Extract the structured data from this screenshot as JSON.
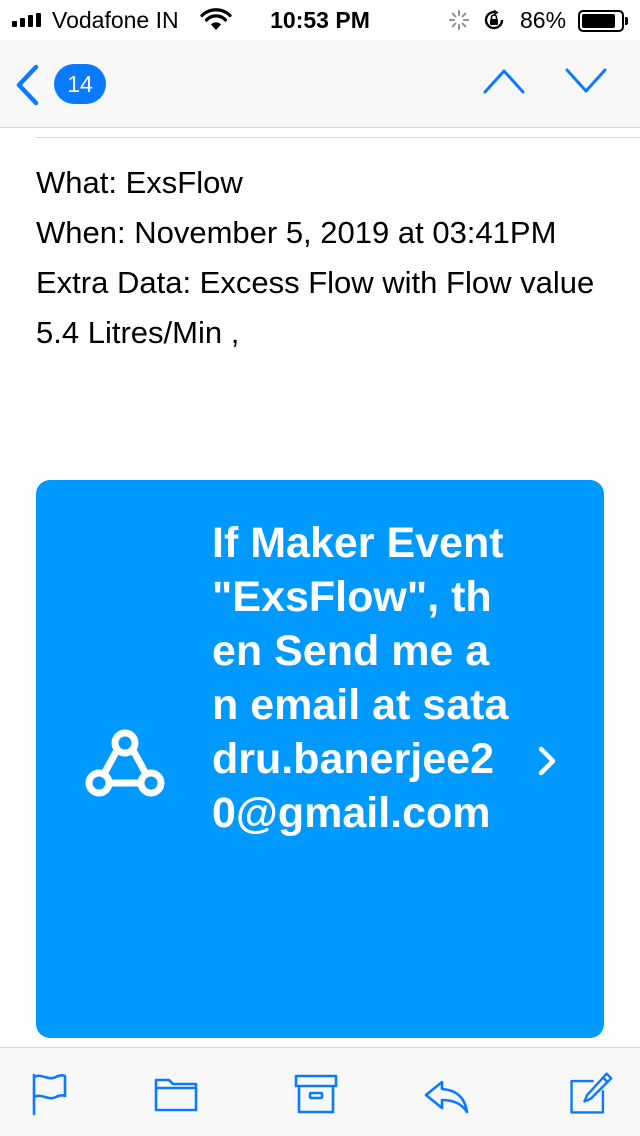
{
  "status_bar": {
    "carrier": "Vodafone IN",
    "time": "10:53 PM",
    "battery_percent": "86%",
    "battery_level": 0.86,
    "icons": [
      "signal-icon",
      "wifi-icon",
      "activity-spinner-icon",
      "rotation-lock-icon",
      "battery-icon"
    ]
  },
  "nav": {
    "back_badge": "14",
    "icons": [
      "back-chevron-icon",
      "chevron-up-icon",
      "chevron-down-icon"
    ]
  },
  "email": {
    "lines": [
      "What: ExsFlow",
      "When: November 5, 2019 at 03:41PM",
      "Extra Data: Excess Flow with Flow value 5.4 Litres/Min ,"
    ]
  },
  "card": {
    "text": "If Maker Event \"ExsFlow\", then Send me an email at satadru.banerjee20@gmail.com",
    "color": "#0099ff",
    "icons": [
      "webhook-icon",
      "chevron-right-icon"
    ]
  },
  "toolbar": {
    "accent": "#0a7aff",
    "icons": [
      "flag-icon",
      "folder-icon",
      "archive-icon",
      "reply-icon",
      "compose-icon"
    ]
  }
}
